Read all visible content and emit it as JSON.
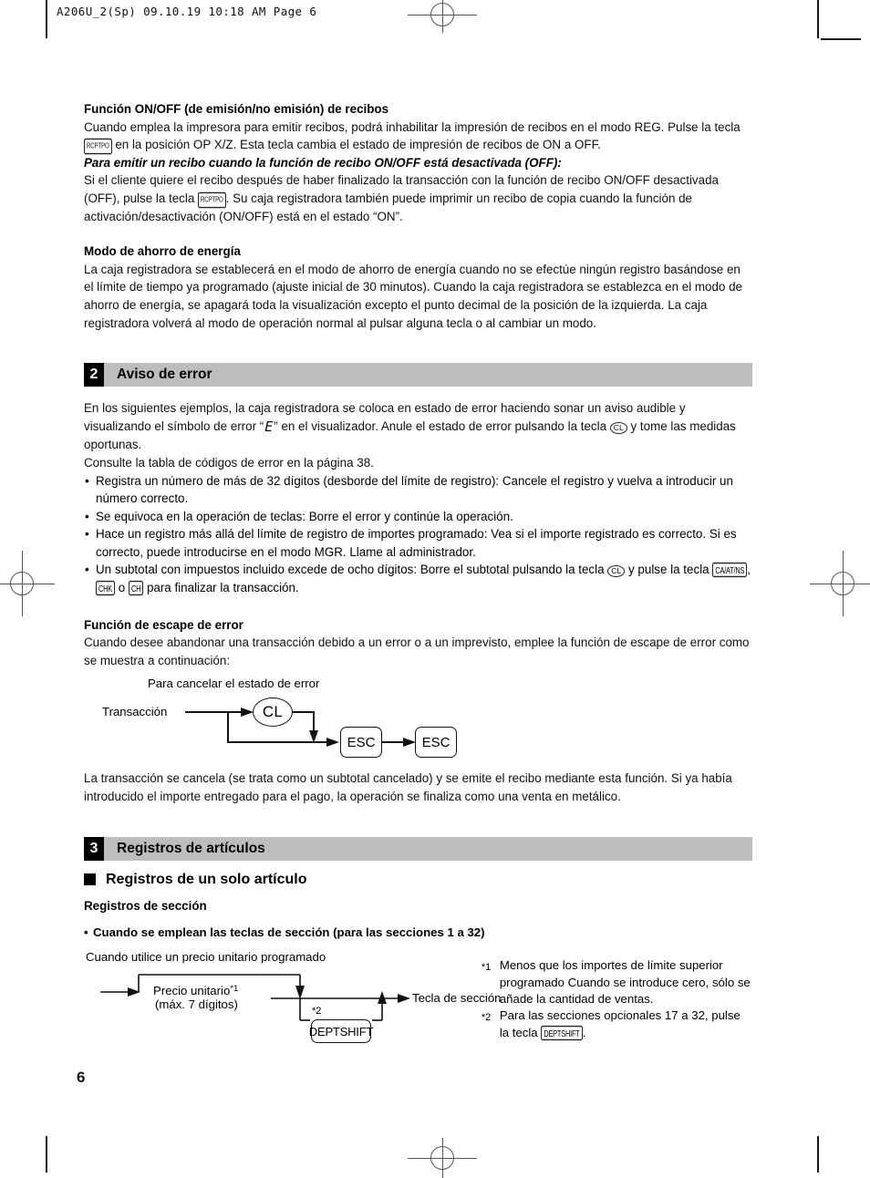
{
  "page": {
    "slug": "A206U_2(Sp)  09.10.19 10:18 AM  Page 6",
    "number": "6",
    "banner_gray": "#bdbdbd"
  },
  "receipt_section": {
    "heading": "Función ON/OFF (de emisión/no emisión) de recibos",
    "para1_a": "Cuando emplea la impresora para emitir recibos, podrá inhabilitar la impresión de recibos en el modo REG. Pulse la tecla",
    "key_rcpt": "RCPTPO",
    "para1_b": "en la posición OP X/Z. Esta tecla cambia el estado de impresión de recibos de ON a OFF.",
    "italic_heading": "Para emitir un recibo cuando la función de recibo ON/OFF está desactivada (OFF):",
    "para2_a": "Si el cliente quiere el recibo después de haber finalizado la transacción con la función de recibo ON/OFF desactivada (OFF), pulse la tecla",
    "para2_b": ". Su caja registradora también puede imprimir un recibo de copia cuando la función de activación/desactivación (ON/OFF) está en el estado “ON”."
  },
  "power_save": {
    "heading": "Modo de ahorro de energía",
    "para": "La caja registradora se establecerá en el modo de ahorro de energía cuando no se efectúe ningún registro basándose en el límite de tiempo ya programado (ajuste inicial de 30 minutos). Cuando la caja registradora se establezca en el modo de ahorro de energía, se apagará toda la visualización excepto el punto decimal de la posición de la izquierda. La caja registradora volverá al modo de operación normal al pulsar alguna tecla o al cambiar un modo."
  },
  "section2": {
    "number": "2",
    "title": "Aviso de error",
    "intro_a": "En los siguientes ejemplos, la caja registradora se coloca en estado de error haciendo sonar un aviso audible y visualizando el símbolo de error “",
    "error_symbol": "E",
    "intro_b": "” en el visualizador. Anule el estado de error pulsando la tecla",
    "key_cl": "CL",
    "intro_c": "y tome las medidas oportunas.",
    "intro_d": "Consulte la tabla de códigos de error en la página 38.",
    "bullets": [
      "Registra un número de más de 32 dígitos (desborde del límite de registro): Cancele el registro y vuelva a introducir un número correcto.",
      "Se equivoca en la operación de teclas: Borre el error y continúe la operación.",
      "Hace un registro más allá del límite de registro de importes programado: Vea si el importe registrado es correcto. Si es correcto, puede introducirse en el modo MGR. Llame al administrador."
    ],
    "bullet4_a": "Un subtotal con impuestos incluido excede de ocho dígitos: Borre el subtotal pulsando la tecla",
    "bullet4_b": "y pulse la tecla",
    "key_cash": "CA/AT/NS",
    "key_chk": "CHK",
    "key_ch": "CH",
    "bullet4_or": "o",
    "bullet4_c": "para finalizar la transacción."
  },
  "escape_function": {
    "heading": "Función de escape de error",
    "para": "Cuando desee abandonar una transacción debido a un error o a un imprevisto, emplee la función de escape de error como se muestra a continuación:",
    "diagram": {
      "caption": "Para cancelar el estado de error",
      "start_label": "Transacción",
      "cl_key": "CL",
      "esc_key_1": "ESC",
      "esc_key_2": "ESC"
    },
    "closing_para": "La transacción se cancela (se trata como un subtotal cancelado) y se emite el recibo mediante esta función. Si ya había introducido el importe entregado para el pago, la operación se finaliza como una venta en metálico."
  },
  "section3": {
    "number": "3",
    "title": "Registros de artículos",
    "square_heading": "Registros de un solo artículo",
    "sub_heading": "Registros de sección",
    "dot_heading": "Cuando se emplean las teclas de sección (para las secciones 1 a 32)",
    "diagram": {
      "caption": "Cuando utilice un precio unitario programado",
      "price_line1": "Precio unitario",
      "price_mark": "*1",
      "price_line2": "(máx. 7 dígitos)",
      "shift_mark": "*2",
      "deptshift_key": "DEPTSHIFT",
      "dept_key_label": "Tecla de sección"
    },
    "footnotes": [
      {
        "mark": "*1",
        "text": "Menos que los importes de límite superior programado Cuando se introduce cero, sólo se añade la cantidad de ventas."
      },
      {
        "mark": "*2",
        "text_a": "Para las secciones opcionales 17 a 32, pulse la tecla",
        "key": "DEPTSHIFT",
        "text_b": "."
      }
    ]
  }
}
